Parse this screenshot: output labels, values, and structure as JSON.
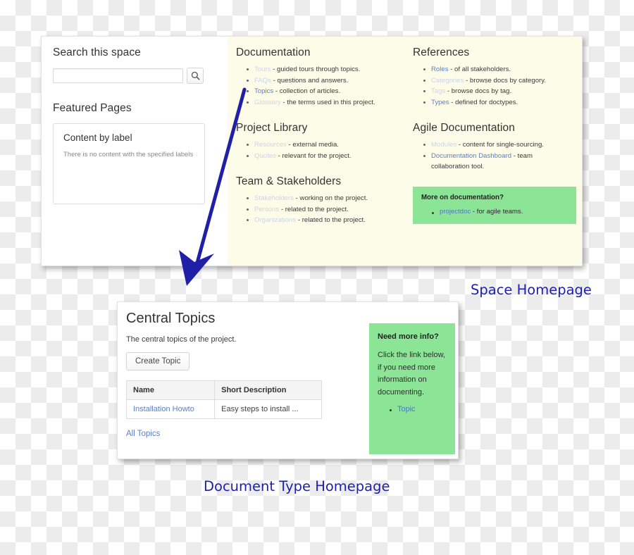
{
  "captions": {
    "space_homepage": "Space Homepage",
    "doctype_homepage": "Document Type Homepage"
  },
  "space_homepage": {
    "left_column": {
      "search_heading": "Search this space",
      "search_value": "",
      "search_placeholder": "",
      "search_icon": "search-icon",
      "featured_heading": "Featured Pages",
      "featured_box": {
        "title": "Content by label",
        "message": "There is no content with the specified labels"
      }
    },
    "middle_column": {
      "sections": [
        {
          "heading": "Documentation",
          "items": [
            {
              "link": "Tours",
              "faded": true,
              "text": " - guided tours through topics."
            },
            {
              "link": "FAQs",
              "faded": true,
              "text": " - questions and answers."
            },
            {
              "link": "Topics",
              "faded": false,
              "text": " - collection of articles."
            },
            {
              "link": "Glossary",
              "faded": true,
              "text": " - the terms used in this project."
            }
          ]
        },
        {
          "heading": "Project Library",
          "items": [
            {
              "link": "Resources",
              "faded": true,
              "text": " - external media."
            },
            {
              "link": "Quotes",
              "faded": true,
              "text": " - relevant for the project."
            }
          ]
        },
        {
          "heading": "Team & Stakeholders",
          "items": [
            {
              "link": "Stakeholders",
              "faded": true,
              "text": " - working on the project."
            },
            {
              "link": "Persons",
              "faded": true,
              "text": " - related to the project."
            },
            {
              "link": "Organizations",
              "faded": true,
              "text": " - related to the project."
            }
          ]
        }
      ]
    },
    "right_column": {
      "sections": [
        {
          "heading": "References",
          "items": [
            {
              "link": "Roles",
              "faded": false,
              "text": " - of all stakeholders."
            },
            {
              "link": "Categories",
              "faded": true,
              "text": " - browse docs by category."
            },
            {
              "link": "Tags",
              "faded": true,
              "text": " - browse docs by tag."
            },
            {
              "link": "Types",
              "faded": false,
              "text": " - defined for doctypes."
            }
          ]
        },
        {
          "heading": "Agile Documentation",
          "items": [
            {
              "link": "Modules",
              "faded": true,
              "text": " - content for single-sourcing."
            },
            {
              "link": "Documentation Dashboard",
              "faded": false,
              "text": " - team collaboration tool."
            }
          ]
        }
      ],
      "callout": {
        "heading": "More on documentation?",
        "items": [
          {
            "link": "projectdoc",
            "text": " - for agile teams."
          }
        ]
      }
    }
  },
  "doctype_homepage": {
    "title": "Central Topics",
    "subtitle": "The central topics of the project.",
    "create_button": "Create Topic",
    "table": {
      "columns": [
        "Name",
        "Short Description"
      ],
      "rows": [
        {
          "name": "Installation Howto",
          "description": "Easy steps to install ..."
        }
      ]
    },
    "all_topics_link": "All Topics",
    "callout": {
      "heading": "Need more info?",
      "body": "Click the link below, if you need more information on documenting.",
      "items": [
        {
          "link": "Topic"
        }
      ]
    }
  },
  "colors": {
    "caption_blue": "#1f1faf",
    "arrow_blue": "#1f1fa8",
    "link_blue": "#5a7fc4",
    "link_faded": "#ccd4e6",
    "callout_green": "#8ce596",
    "panel_cream": "#fcfce9"
  }
}
